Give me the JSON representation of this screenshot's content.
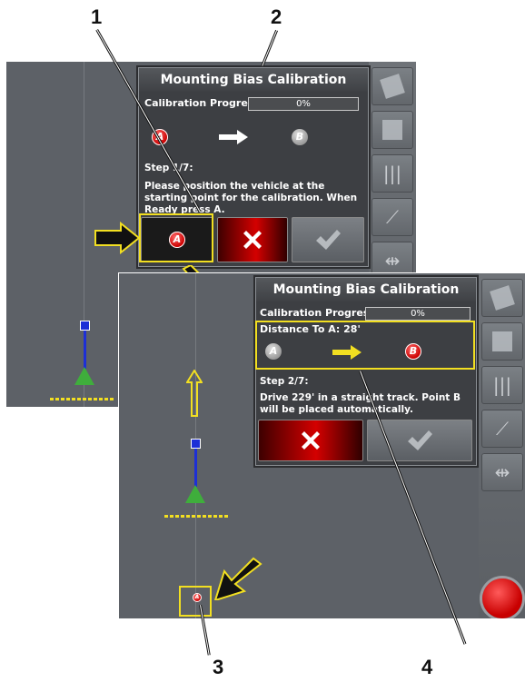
{
  "callouts": {
    "c1": "1",
    "c2": "2",
    "c3": "3",
    "c4": "4"
  },
  "screen1": {
    "dialog": {
      "title": "Mounting Bias Calibration",
      "progress_label": "Calibration Progress:",
      "progress_value": "0%",
      "point_a": "A",
      "point_b": "B",
      "step": "Step 1/7:",
      "instruction": "Please position the vehicle at the starting point for the calibration. When Ready press A.",
      "set_a_button": "A"
    }
  },
  "screen2": {
    "dialog": {
      "title": "Mounting Bias Calibration",
      "progress_label": "Calibration Progress:",
      "progress_value": "0%",
      "distance_label": "Distance To A: 28'",
      "point_a": "A",
      "point_b": "B",
      "step": "Step 2/7:",
      "instruction": "Drive 229' in a straight track. Point B will be placed automatically."
    },
    "map_point": "A"
  },
  "colors": {
    "highlight": "#f2df21",
    "red": "#d40000",
    "screen_bg": "#5d6167"
  }
}
